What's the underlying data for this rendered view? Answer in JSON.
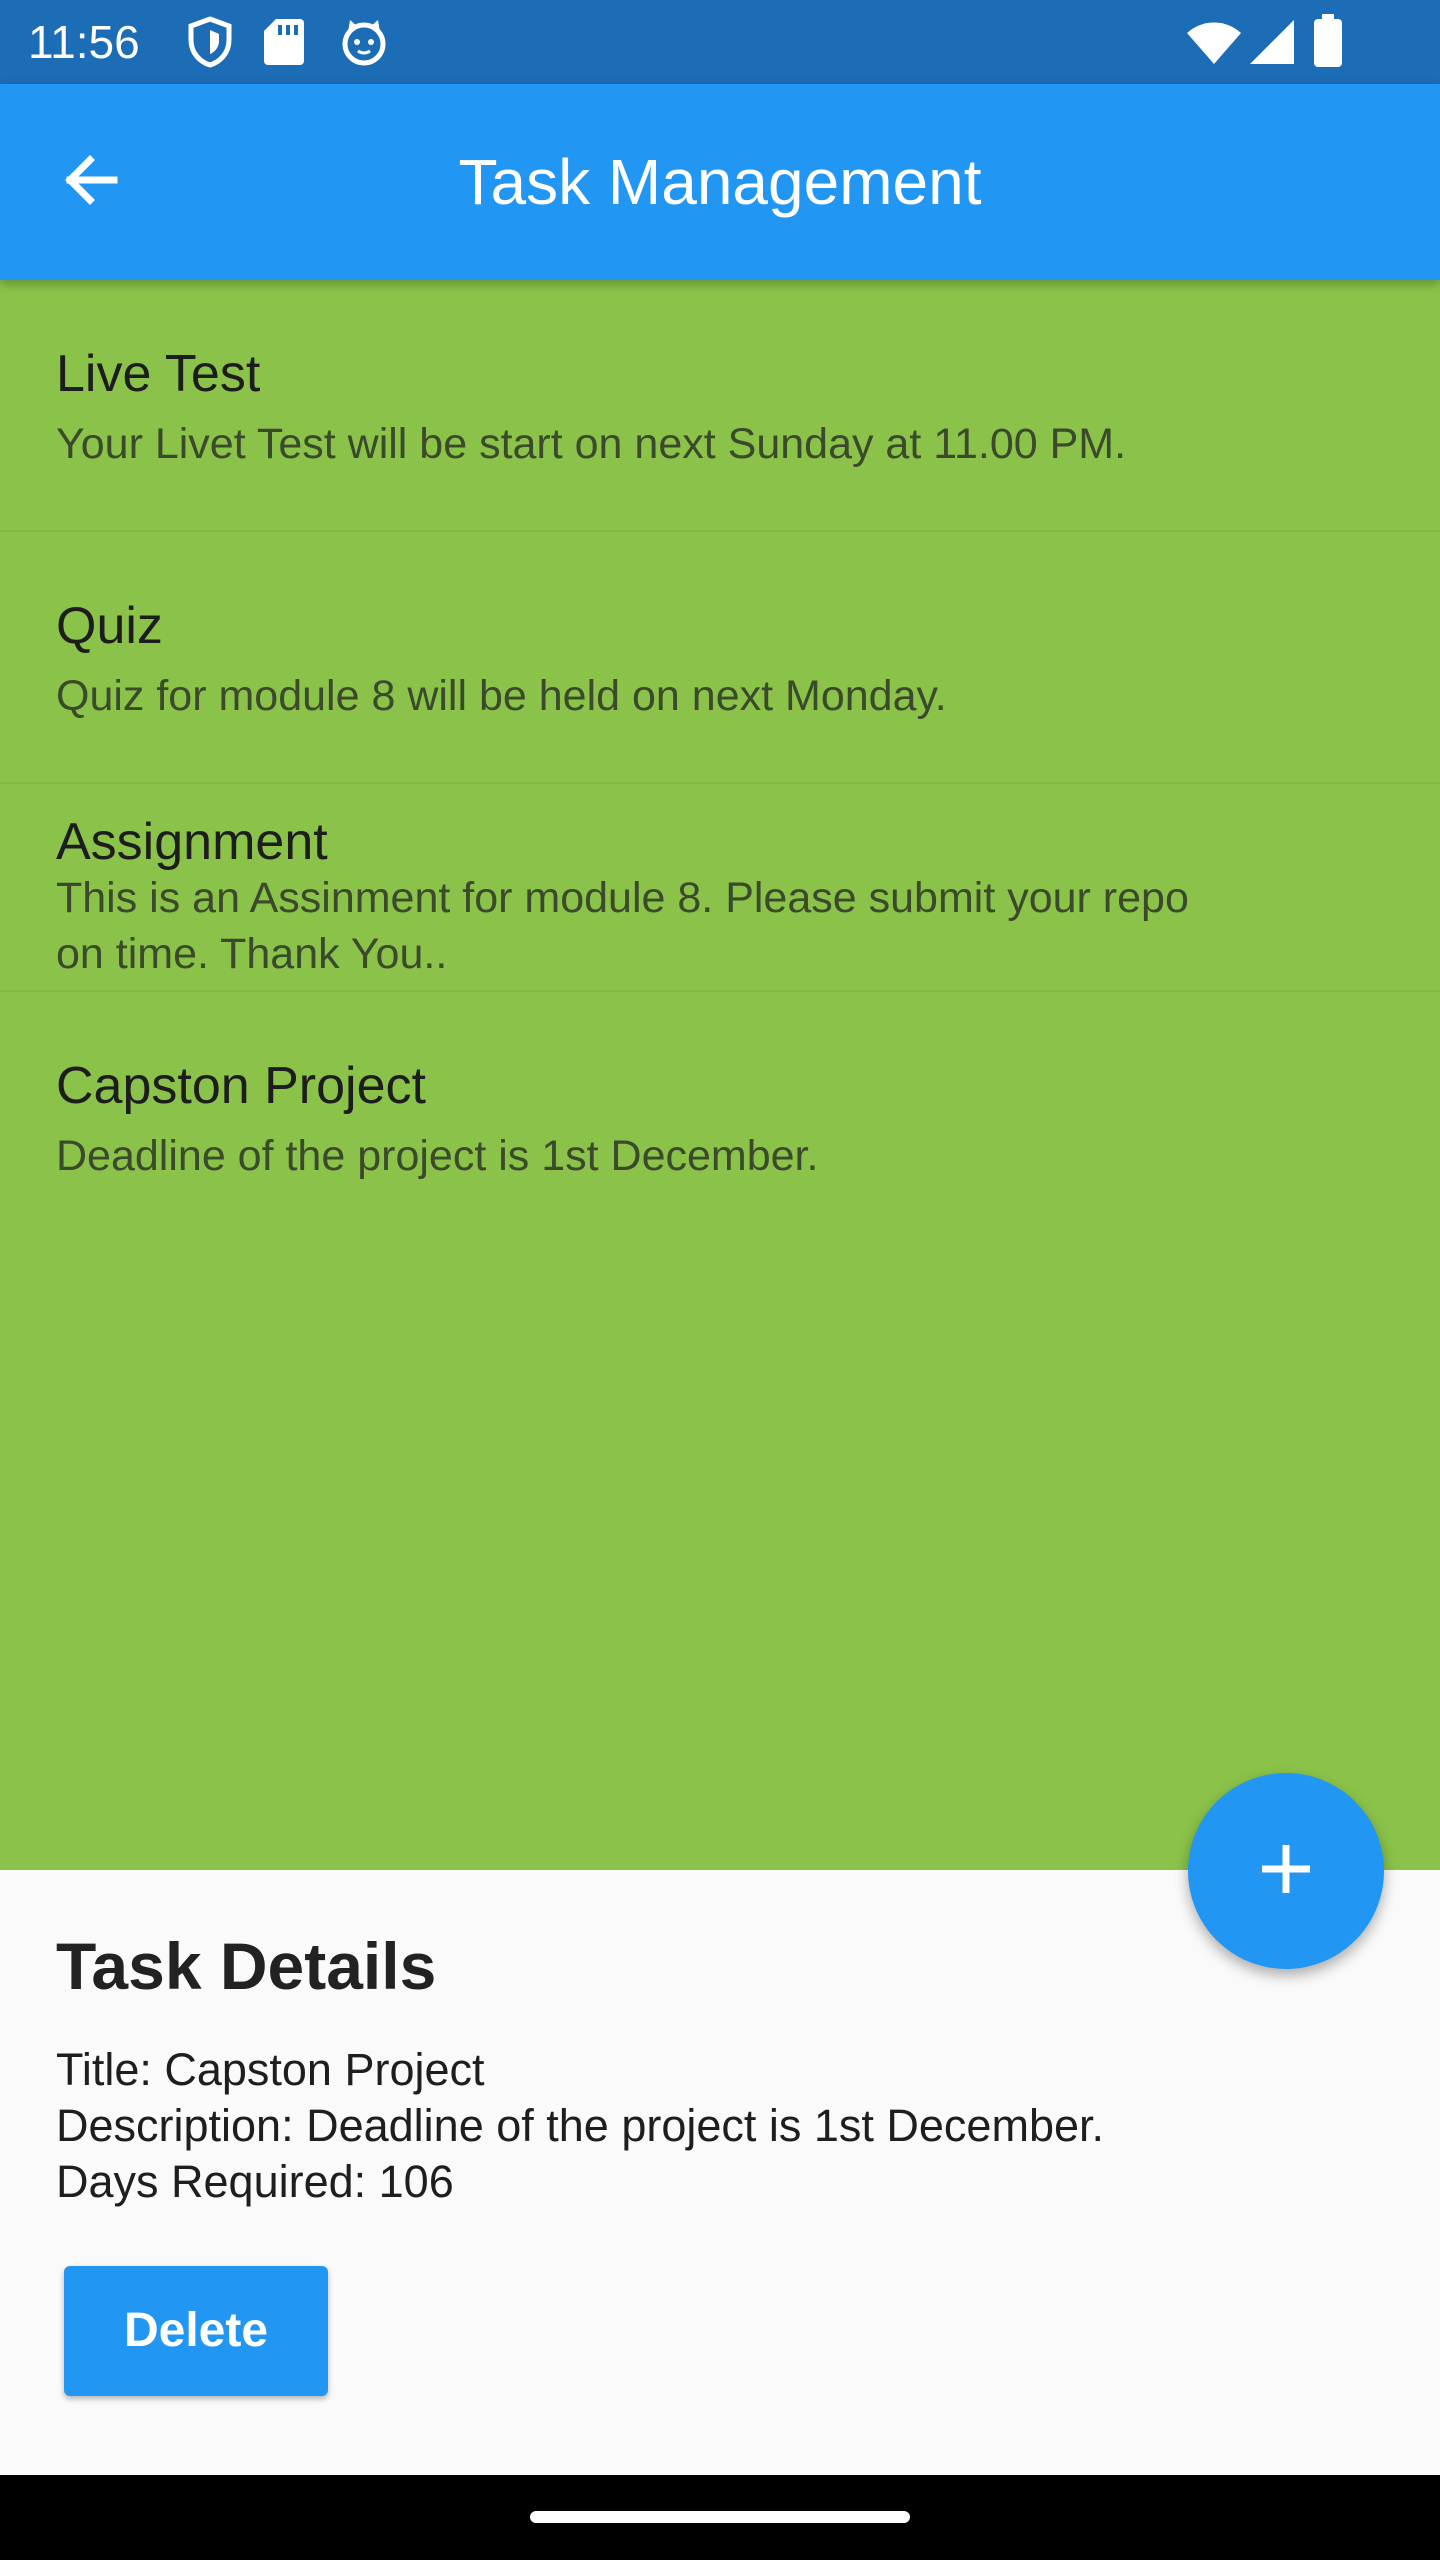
{
  "status_bar": {
    "time": "11:56",
    "left_icons": [
      "shield-icon",
      "sd-card-icon",
      "cat-face-icon"
    ],
    "right_icons": [
      "wifi-icon",
      "signal-icon",
      "battery-icon"
    ]
  },
  "app_bar": {
    "title": "Task Management",
    "back_icon": "arrow-back-icon",
    "color": "#2196f3"
  },
  "task_list": {
    "background": "#8bc34a",
    "items": [
      {
        "title": "Live Test",
        "description": "Your Livet Test will be start on next Sunday at 11.00 PM."
      },
      {
        "title": "Quiz",
        "description": "Quiz for module 8 will be held on next Monday."
      },
      {
        "title": "Assignment",
        "description": "This is an Assinment for module 8. Please submit your repo\non time. Thank You.."
      },
      {
        "title": "Capston Project",
        "description": "Deadline of the project is 1st December."
      }
    ]
  },
  "fab": {
    "icon": "plus-icon"
  },
  "details": {
    "heading": "Task Details",
    "title_line": "Title: Capston Project",
    "description_line": "Description: Deadline of the project is 1st December.",
    "days_line": "Days Required: 106",
    "delete_label": "Delete"
  }
}
